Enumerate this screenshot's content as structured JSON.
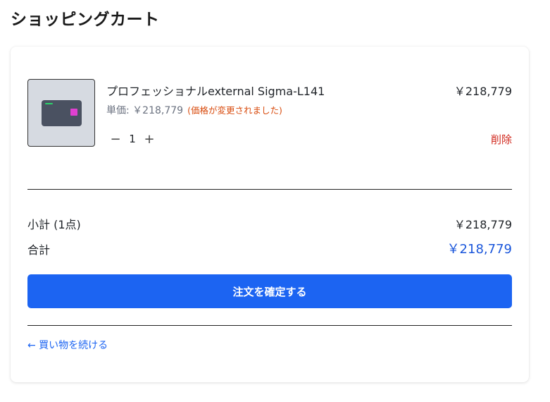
{
  "page": {
    "title": "ショッピングカート"
  },
  "cart": {
    "items": [
      {
        "name": "プロフェッショナルexternal Sigma-L141",
        "price": "￥218,779",
        "unit_label": "単価: ",
        "unit_price": "￥218,779",
        "price_notice": "(価格が変更されました)",
        "quantity": "1",
        "decrement_icon": "−",
        "increment_icon": "+",
        "delete_label": "削除",
        "thumbnail_icon": "device-icon"
      }
    ]
  },
  "summary": {
    "subtotal_label": "小計 (1点)",
    "subtotal_value": "￥218,779",
    "total_label": "合計",
    "total_value": "￥218,779"
  },
  "actions": {
    "checkout_label": "注文を確定する",
    "continue_label": "← 買い物を続ける"
  },
  "colors": {
    "accent": "#1c64f2",
    "total": "#1a56db",
    "notice": "#d94d10",
    "danger": "#d0261b"
  }
}
